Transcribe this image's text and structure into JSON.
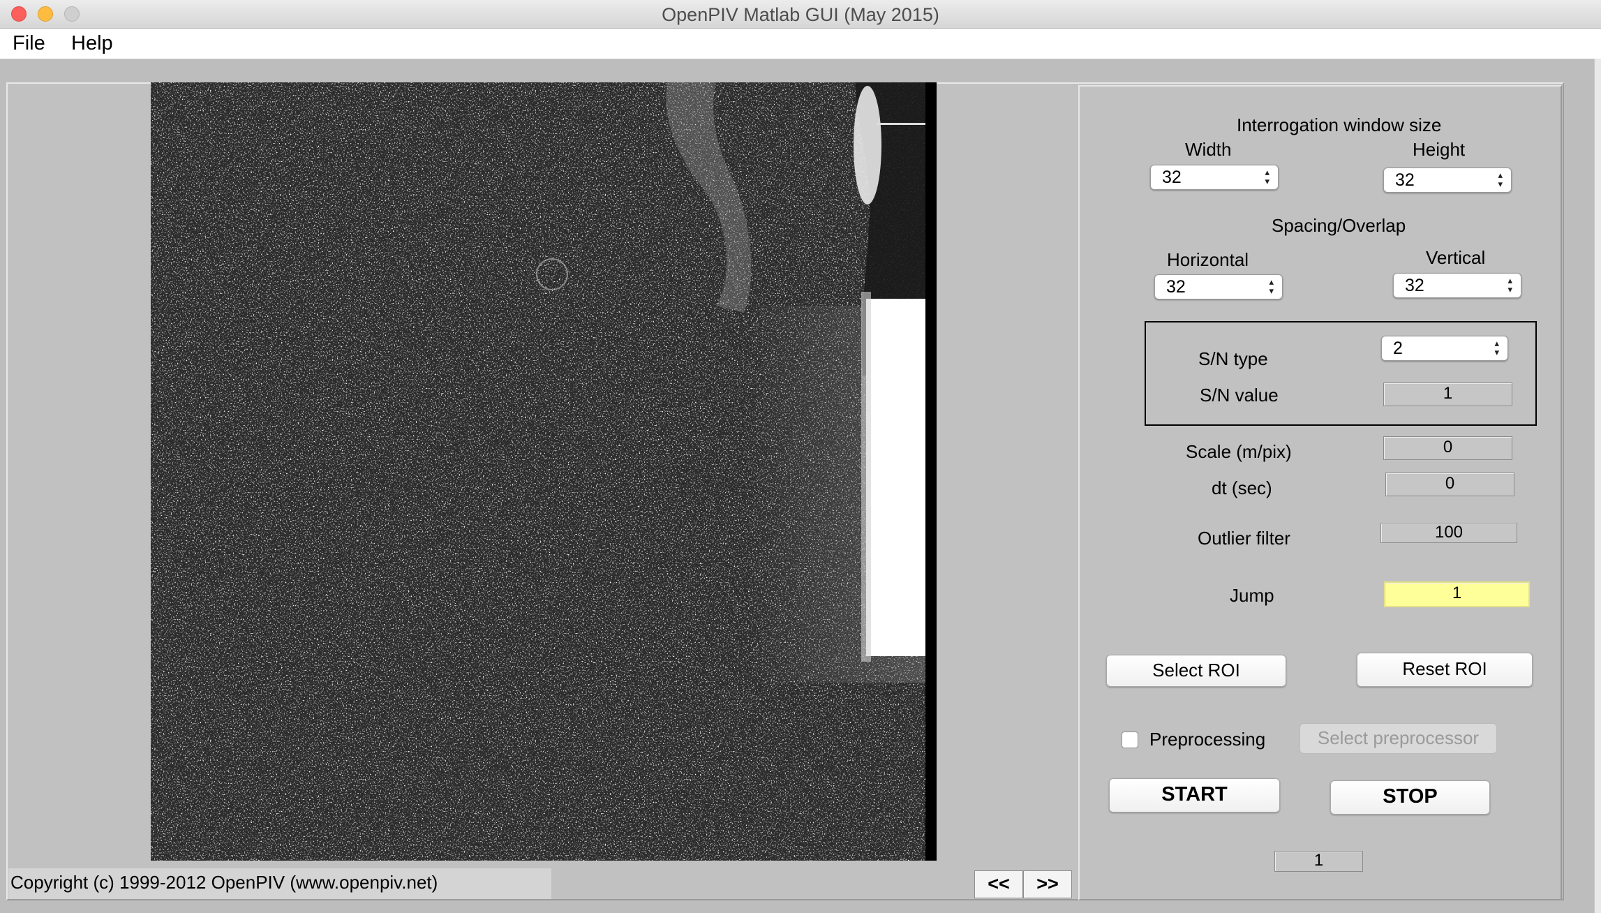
{
  "window": {
    "title": "OpenPIV Matlab GUI (May 2015)"
  },
  "menubar": {
    "items": [
      "File",
      "Help"
    ]
  },
  "panel": {
    "interrogation_title": "Interrogation window size",
    "width_label": "Width",
    "width_value": "32",
    "height_label": "Height",
    "height_value": "32",
    "spacing_title": "Spacing/Overlap",
    "horizontal_label": "Horizontal",
    "horizontal_value": "32",
    "vertical_label": "Vertical",
    "vertical_value": "32",
    "sn_type_label": "S/N type",
    "sn_type_value": "2",
    "sn_value_label": "S/N value",
    "sn_value": "1",
    "scale_label": "Scale (m/pix)",
    "scale_value": "0",
    "dt_label": "dt (sec)",
    "dt_value": "0",
    "outlier_label": "Outlier filter",
    "outlier_value": "100",
    "jump_label": "Jump",
    "jump_value": "1",
    "select_roi": "Select ROI",
    "reset_roi": "Reset ROI",
    "preprocessing_label": "Preprocessing",
    "preprocessing_checked": false,
    "select_preprocessor": "Select preprocessor",
    "start": "START",
    "stop": "STOP",
    "frame_counter": "1"
  },
  "footer": {
    "copyright": "Copyright (c) 1999-2012 OpenPIV (www.openpiv.net)",
    "prev": "<<",
    "next": ">>"
  },
  "colors": {
    "window_bg": "#bdbdbd",
    "jump_highlight": "#ffff99",
    "close_light": "#fc605c",
    "minimize_light": "#fdbc40"
  }
}
